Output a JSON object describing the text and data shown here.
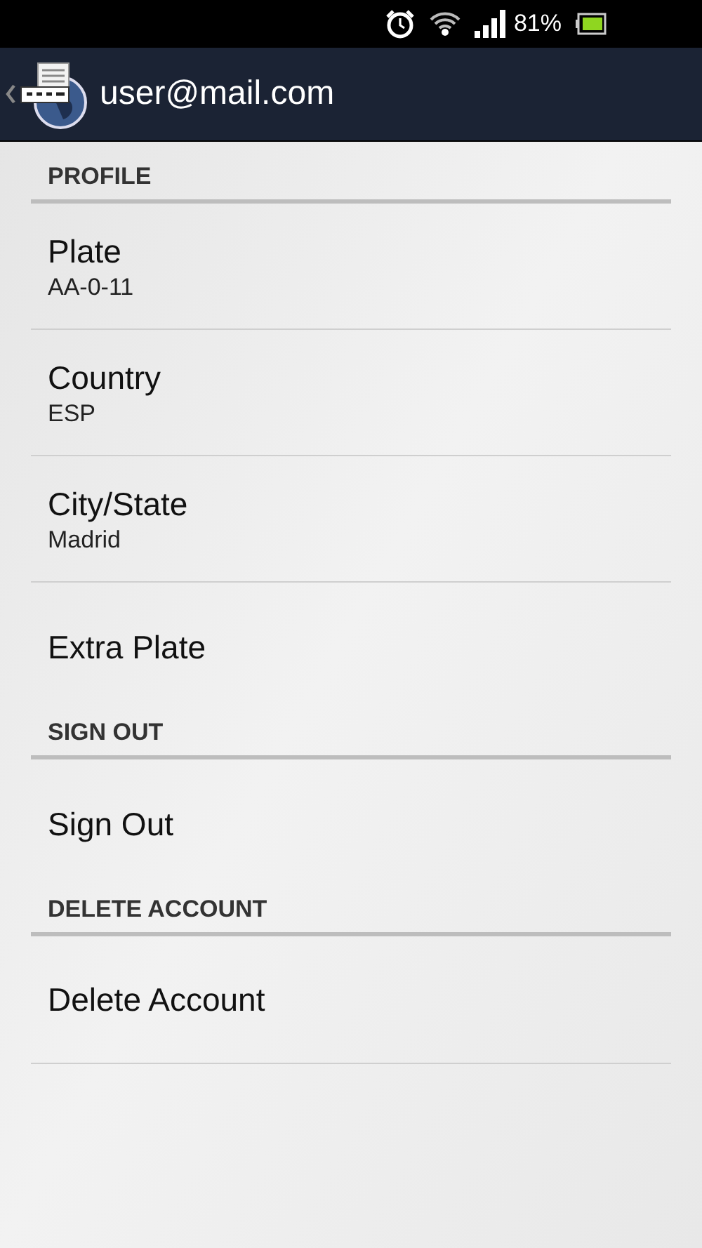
{
  "status_bar": {
    "battery": "81%"
  },
  "action_bar": {
    "title": "user@mail.com"
  },
  "sections": [
    {
      "header": "PROFILE",
      "items": [
        {
          "title": "Plate",
          "summary": "AA-0-11"
        },
        {
          "title": "Country",
          "summary": "ESP"
        },
        {
          "title": "City/State",
          "summary": "Madrid"
        },
        {
          "title": "Extra Plate"
        }
      ]
    },
    {
      "header": "SIGN OUT",
      "items": [
        {
          "title": "Sign Out"
        }
      ]
    },
    {
      "header": "DELETE ACCOUNT",
      "items": [
        {
          "title": "Delete Account"
        }
      ]
    }
  ]
}
